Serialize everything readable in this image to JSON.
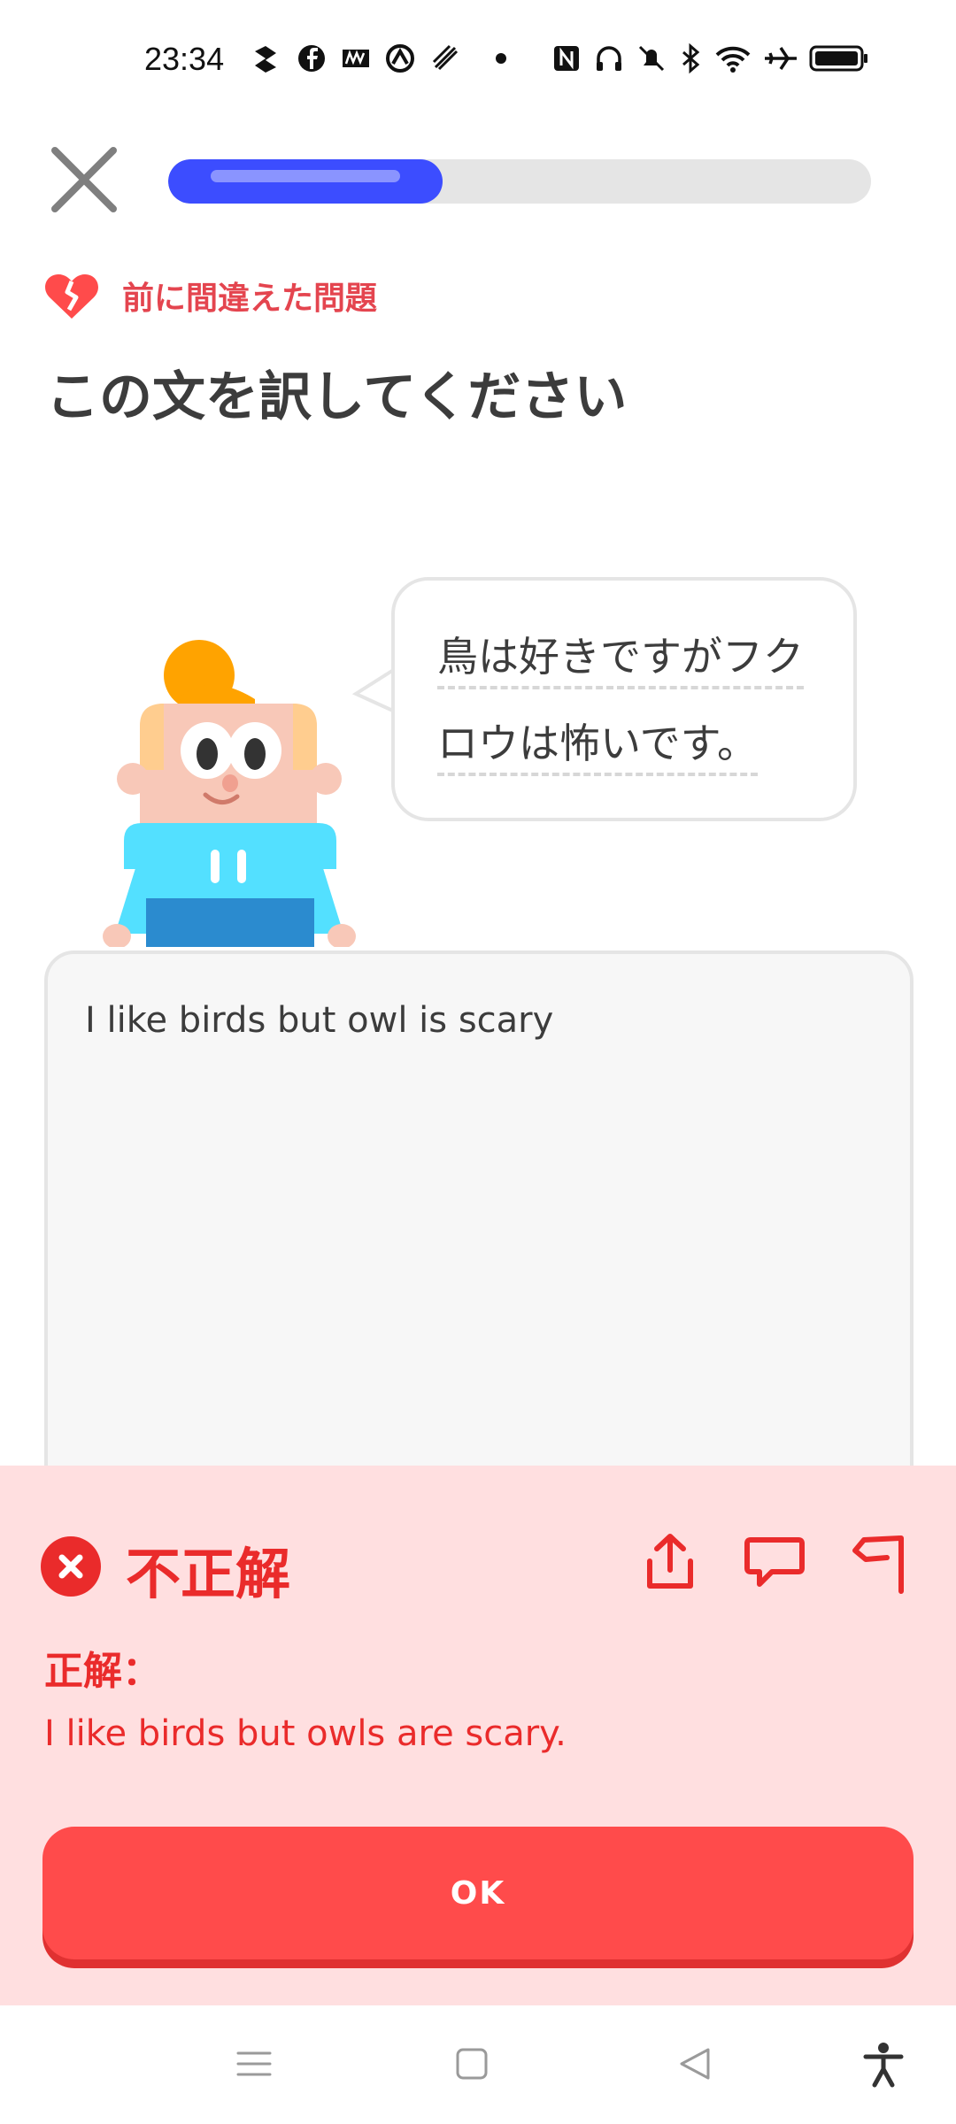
{
  "status_bar": {
    "time": "23:34",
    "left_icons": [
      "app-icon",
      "facebook-icon",
      "news-icon",
      "app-icon",
      "app-icon",
      "dot-icon"
    ],
    "right_icons": [
      "nfc-icon",
      "headphones-icon",
      "mute-icon",
      "bluetooth-icon",
      "wifi-icon",
      "airplane-icon",
      "battery-icon"
    ]
  },
  "header": {
    "progress": 0.39
  },
  "mistake_tag": {
    "icon": "broken-heart-icon",
    "label": "前に間違えた問題"
  },
  "prompt": {
    "title": "この文を訳してください"
  },
  "bubble": {
    "line1": "鳥は好きですがフク",
    "line2": "ロウは怖いです。"
  },
  "answer": {
    "text": "I like birds but owl is scary"
  },
  "feedback": {
    "title": "不正解",
    "correct_label": "正解：",
    "correct_answer": "I like birds but owls are scary.",
    "ok_label": "OK",
    "colors": {
      "panel": "#ffdfe0",
      "accent": "#ea2b2b",
      "button": "#ff4b4b"
    }
  },
  "nav": {
    "icons": [
      "menu-icon",
      "home-icon",
      "back-icon",
      "accessibility-icon"
    ]
  }
}
